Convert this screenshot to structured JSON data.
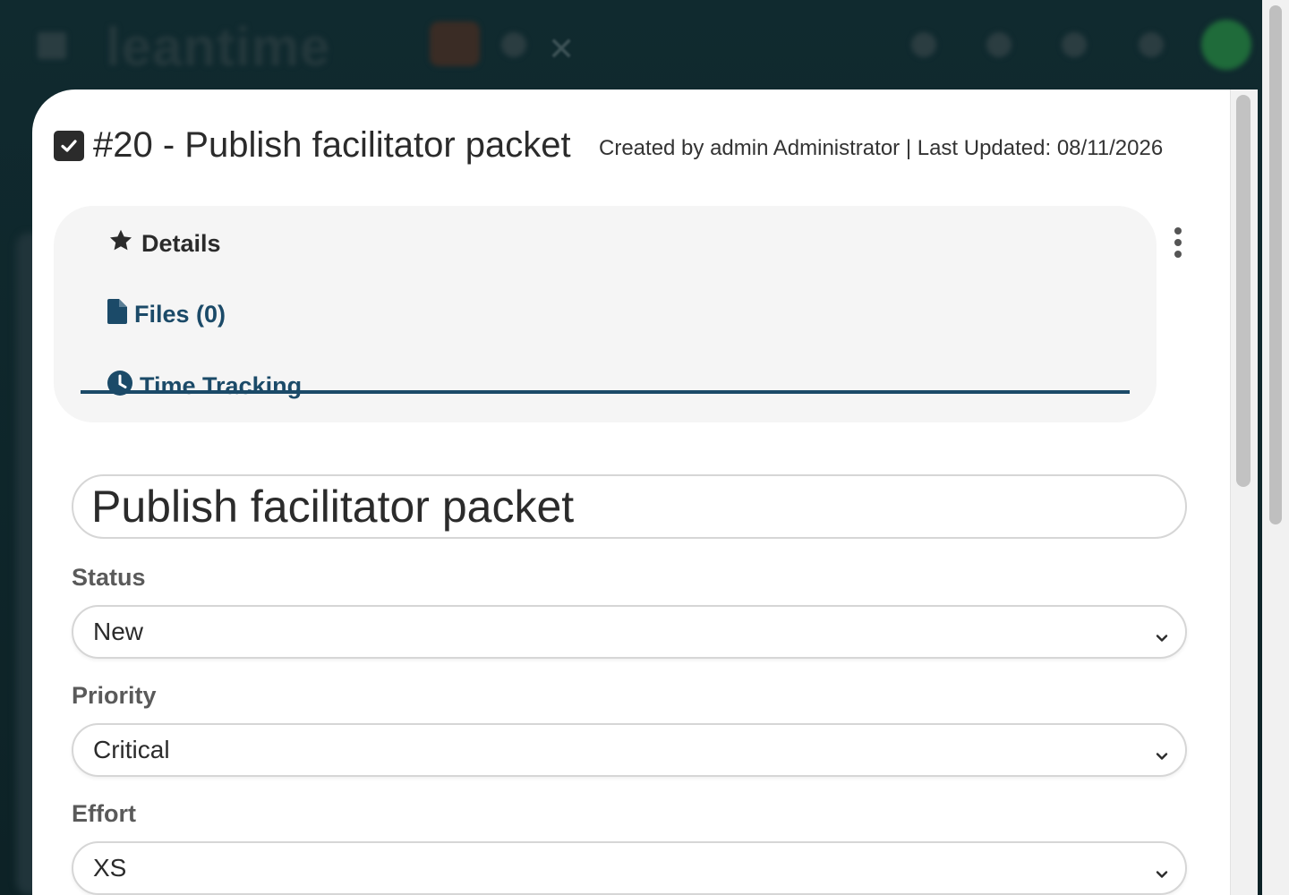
{
  "background": {
    "logo_text": "leantime"
  },
  "ticket": {
    "title": "#20 - Publish facilitator packet",
    "meta": "Created by admin Administrator | Last Updated: 08/11/2026"
  },
  "tabs": [
    {
      "label": "Details",
      "icon": "star-icon",
      "active": true
    },
    {
      "label": "Files (0)",
      "icon": "file-icon",
      "active": false
    },
    {
      "label": "Time Tracking",
      "icon": "clock-icon",
      "active": false
    }
  ],
  "form": {
    "headline_value": "Publish facilitator packet",
    "status_label": "Status",
    "status_value": "New",
    "priority_label": "Priority",
    "priority_value": "Critical",
    "effort_label": "Effort",
    "effort_value": "XS"
  },
  "colors": {
    "accent": "#1b4a68",
    "text": "#2b2b2b",
    "label": "#5a5a5a",
    "panel": "#f5f5f5"
  }
}
